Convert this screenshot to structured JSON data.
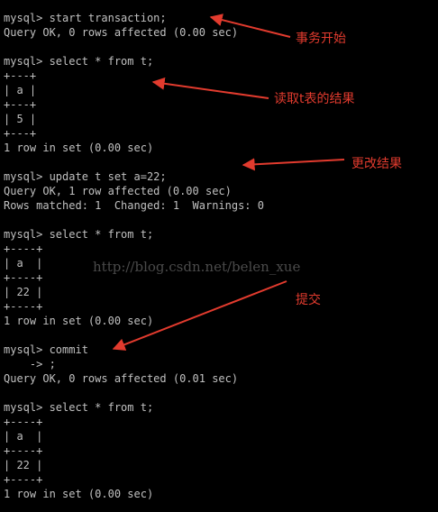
{
  "terminal": {
    "lines": [
      "mysql> start transaction;",
      "Query OK, 0 rows affected (0.00 sec)",
      "",
      "mysql> select * from t;",
      "+---+",
      "| a |",
      "+---+",
      "| 5 |",
      "+---+",
      "1 row in set (0.00 sec)",
      "",
      "mysql> update t set a=22;",
      "Query OK, 1 row affected (0.00 sec)",
      "Rows matched: 1  Changed: 1  Warnings: 0",
      "",
      "mysql> select * from t;",
      "+----+",
      "| a  |",
      "+----+",
      "| 22 |",
      "+----+",
      "1 row in set (0.00 sec)",
      "",
      "mysql> commit",
      "    -> ;",
      "Query OK, 0 rows affected (0.01 sec)",
      "",
      "mysql> select * from t;",
      "+----+",
      "| a  |",
      "+----+",
      "| 22 |",
      "+----+",
      "1 row in set (0.00 sec)"
    ]
  },
  "watermark": "http://blog.csdn.net/belen_xue",
  "annotations": {
    "start": "事务开始",
    "read": "读取t表的结果",
    "change": "更改结果",
    "commit": "提交"
  },
  "colors": {
    "background": "#000000",
    "text": "#c0c0c0",
    "annotation": "#e23b2e",
    "watermark": "#4a4a4a"
  }
}
